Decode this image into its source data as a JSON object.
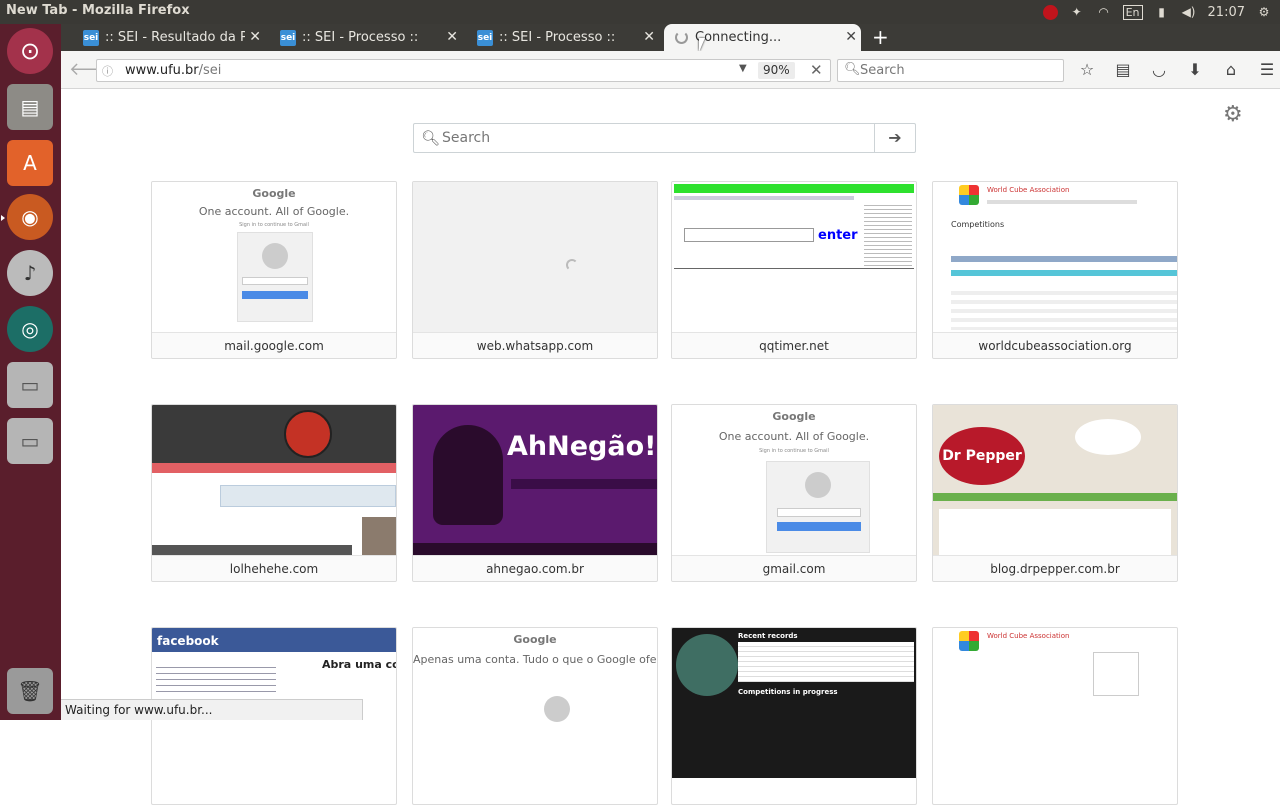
{
  "window": {
    "title": "New Tab - Mozilla Firefox"
  },
  "tray": {
    "keyboard": "En",
    "time": "21:07"
  },
  "tabs": [
    {
      "label": ":: SEI - Resultado da Pe",
      "favicon": "sei"
    },
    {
      "label": ":: SEI - Processo ::",
      "favicon": "sei"
    },
    {
      "label": ":: SEI - Processo ::",
      "favicon": "sei"
    },
    {
      "label": "Connecting...",
      "favicon": "spinner"
    }
  ],
  "nav": {
    "url_host": "www.ufu.br",
    "url_path": "/sei",
    "zoom": "90%",
    "search_placeholder": "Search"
  },
  "page": {
    "search_placeholder": "Search",
    "tiles": [
      {
        "caption": "mail.google.com"
      },
      {
        "caption": "web.whatsapp.com"
      },
      {
        "caption": "qqtimer.net"
      },
      {
        "caption": "worldcubeassociation.org"
      },
      {
        "caption": "lolhehehe.com"
      },
      {
        "caption": "ahnegao.com.br"
      },
      {
        "caption": "gmail.com"
      },
      {
        "caption": "blog.drpepper.com.br"
      }
    ],
    "thumb_text": {
      "google_logo": "Google",
      "google_heading": "One account. All of Google.",
      "google_sub": "Sign in to continue to Gmail",
      "qq_enter": "enter",
      "wca_title": "World Cube Association",
      "wca_comp": "Competitions",
      "ahnegao_logo": "AhNegão!",
      "dr_logo": "Dr Pepper",
      "fb_logo": "facebook",
      "fb_headline": "Abra uma conta",
      "google_pt_heading": "Apenas uma conta. Tudo o que o Google ofer",
      "records_title": "Recent records",
      "records_sub": "Competitions in progress"
    }
  },
  "status": {
    "text": "Waiting for www.ufu.br..."
  }
}
